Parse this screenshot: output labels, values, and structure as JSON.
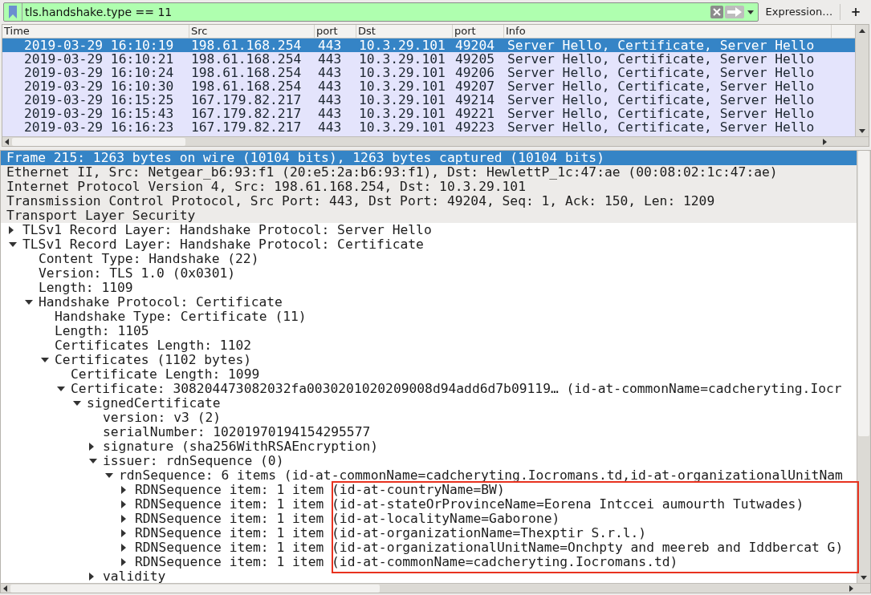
{
  "filter": {
    "value": "tls.handshake.type == 11",
    "expression_button": "Expression…",
    "add_button": "+"
  },
  "packet_list": {
    "columns": [
      "Time",
      "Src",
      "port",
      "Dst",
      "port",
      "Info"
    ],
    "rows": [
      {
        "cells": [
          "2019-03-29 16:10:19",
          "198.61.168.254",
          "443",
          "10.3.29.101",
          "49204",
          "Server Hello, Certificate, Server Hello"
        ],
        "selected": true
      },
      {
        "cells": [
          "2019-03-29 16:10:21",
          "198.61.168.254",
          "443",
          "10.3.29.101",
          "49205",
          "Server Hello, Certificate, Server Hello"
        ],
        "selected": false
      },
      {
        "cells": [
          "2019-03-29 16:10:24",
          "198.61.168.254",
          "443",
          "10.3.29.101",
          "49206",
          "Server Hello, Certificate, Server Hello"
        ],
        "selected": false
      },
      {
        "cells": [
          "2019-03-29 16:10:30",
          "198.61.168.254",
          "443",
          "10.3.29.101",
          "49207",
          "Server Hello, Certificate, Server Hello"
        ],
        "selected": false
      },
      {
        "cells": [
          "2019-03-29 16:15:25",
          "167.179.82.217",
          "443",
          "10.3.29.101",
          "49214",
          "Server Hello, Certificate, Server Hello"
        ],
        "selected": false
      },
      {
        "cells": [
          "2019-03-29 16:15:43",
          "167.179.82.217",
          "443",
          "10.3.29.101",
          "49221",
          "Server Hello, Certificate, Server Hello"
        ],
        "selected": false
      },
      {
        "cells": [
          "2019-03-29 16:16:23",
          "167.179.82.217",
          "443",
          "10.3.29.101",
          "49223",
          "Server Hello, Certificate, Server Hello"
        ],
        "selected": false
      }
    ]
  },
  "details": {
    "tree": [
      {
        "text": "Frame 215: 1263 bytes on wire (10104 bits), 1263 bytes captured (10104 bits)",
        "selected": true
      },
      {
        "text": "Ethernet II, Src: Netgear_b6:93:f1 (20:e5:2a:b6:93:f1), Dst: HewlettP_1c:47:ae (00:08:02:1c:47:ae)",
        "selected": false
      },
      {
        "text": "Internet Protocol Version 4, Src: 198.61.168.254, Dst: 10.3.29.101",
        "selected": false
      },
      {
        "text": "Transmission Control Protocol, Src Port: 443, Dst Port: 49204, Seq: 1, Ack: 150, Len: 1209",
        "selected": false
      },
      {
        "text": "Transport Layer Security",
        "selected": false,
        "children": [
          {
            "text": "TLSv1 Record Layer: Handshake Protocol: Server Hello",
            "selected": false,
            "expanded": false
          },
          {
            "text": "TLSv1 Record Layer: Handshake Protocol: Certificate",
            "selected": false,
            "expanded": true,
            "children": [
              {
                "text": "Content Type: Handshake (22)",
                "selected": false
              },
              {
                "text": "Version: TLS 1.0 (0x0301)",
                "selected": false
              },
              {
                "text": "Length: 1109",
                "selected": false
              },
              {
                "text": "Handshake Protocol: Certificate",
                "selected": false,
                "expanded": true,
                "children": [
                  {
                    "text": "Handshake Type: Certificate (11)",
                    "selected": false
                  },
                  {
                    "text": "Length: 1105",
                    "selected": false
                  },
                  {
                    "text": "Certificates Length: 1102",
                    "selected": false
                  },
                  {
                    "text": "Certificates (1102 bytes)",
                    "selected": false,
                    "expanded": true,
                    "children": [
                      {
                        "text": "Certificate Length: 1099",
                        "selected": false
                      },
                      {
                        "text": "Certificate: 308204473082032fa0030201020209008d94add6d7b09119… (id-at-commonName=cadcheryting.Iocr",
                        "selected": false,
                        "expanded": true,
                        "children": [
                          {
                            "text": "signedCertificate",
                            "selected": false,
                            "expanded": true,
                            "children": [
                              {
                                "text": "version: v3 (2)",
                                "selected": false
                              },
                              {
                                "text": "serialNumber: 10201970194154295577",
                                "selected": false
                              },
                              {
                                "text": "signature (sha256WithRSAEncryption)",
                                "selected": false,
                                "expanded": false
                              },
                              {
                                "text": "issuer: rdnSequence (0)",
                                "selected": false,
                                "expanded": true,
                                "children": [
                                  {
                                    "text": "rdnSequence: 6 items (id-at-commonName=cadcheryting.Iocromans.td,id-at-organizationalUnitNam",
                                    "selected": false,
                                    "expanded": true,
                                    "children": [
                                      {
                                        "text": "RDNSequence item: 1 item (id-at-countryName=BW)",
                                        "selected": false,
                                        "expanded": false
                                      },
                                      {
                                        "text": "RDNSequence item: 1 item (id-at-stateOrProvinceName=Eorena Intccei aumourth Tutwades)",
                                        "selected": false,
                                        "expanded": false
                                      },
                                      {
                                        "text": "RDNSequence item: 1 item (id-at-localityName=Gaborone)",
                                        "selected": false,
                                        "expanded": false
                                      },
                                      {
                                        "text": "RDNSequence item: 1 item (id-at-organizationName=Thexptir S.r.l.)",
                                        "selected": false,
                                        "expanded": false
                                      },
                                      {
                                        "text": "RDNSequence item: 1 item (id-at-organizationalUnitName=Onchpty and meereb and Iddbercat G)",
                                        "selected": false,
                                        "expanded": false
                                      },
                                      {
                                        "text": "RDNSequence item: 1 item (id-at-commonName=cadcheryting.Iocromans.td)",
                                        "selected": false,
                                        "expanded": false
                                      }
                                    ]
                                  }
                                ]
                              },
                              {
                                "text": "validity",
                                "selected": false,
                                "expanded": false
                              }
                            ]
                          }
                        ]
                      }
                    ]
                  }
                ]
              }
            ]
          }
        ]
      }
    ]
  }
}
